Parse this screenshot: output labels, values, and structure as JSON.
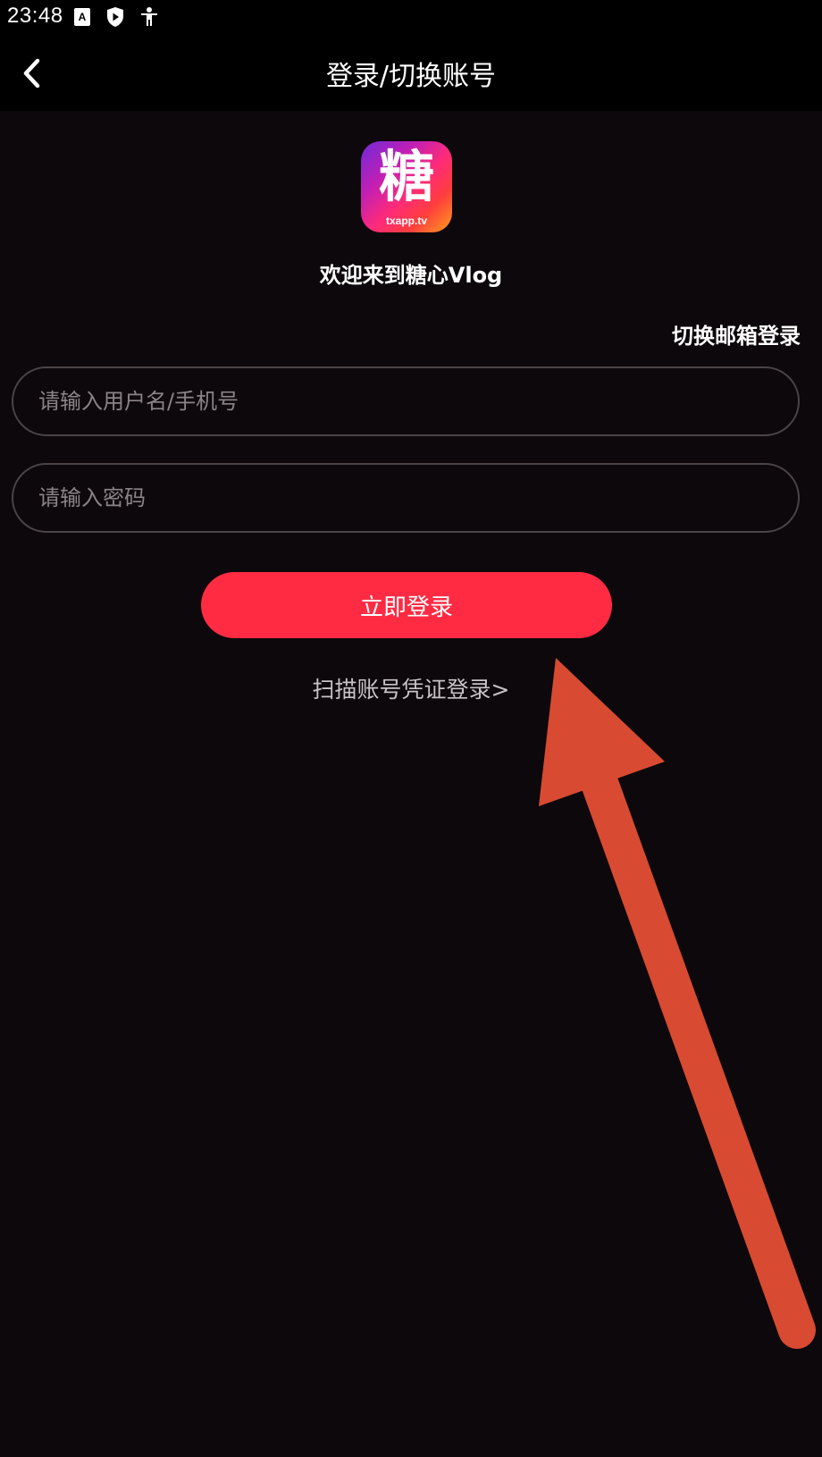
{
  "status_bar": {
    "time": "23:48",
    "icons": [
      "accessibility-a-icon",
      "shield-play-icon",
      "person-icon"
    ]
  },
  "header": {
    "title": "登录/切换账号",
    "back_icon": "chevron-left-icon"
  },
  "logo": {
    "glyph": "糖",
    "caption": "txapp.tv"
  },
  "welcome_text": "欢迎来到糖心Vlog",
  "switch_email_label": "切换邮箱登录",
  "form": {
    "username_placeholder": "请输入用户名/手机号",
    "username_value": "",
    "password_placeholder": "请输入密码",
    "password_value": ""
  },
  "login_button_label": "立即登录",
  "scan_link_label": "扫描账号凭证登录>",
  "colors": {
    "background": "#0d080b",
    "header": "#000000",
    "accent": "#ff2b43",
    "field_border": "#4a4447",
    "annotation_arrow": "#d84a32"
  }
}
